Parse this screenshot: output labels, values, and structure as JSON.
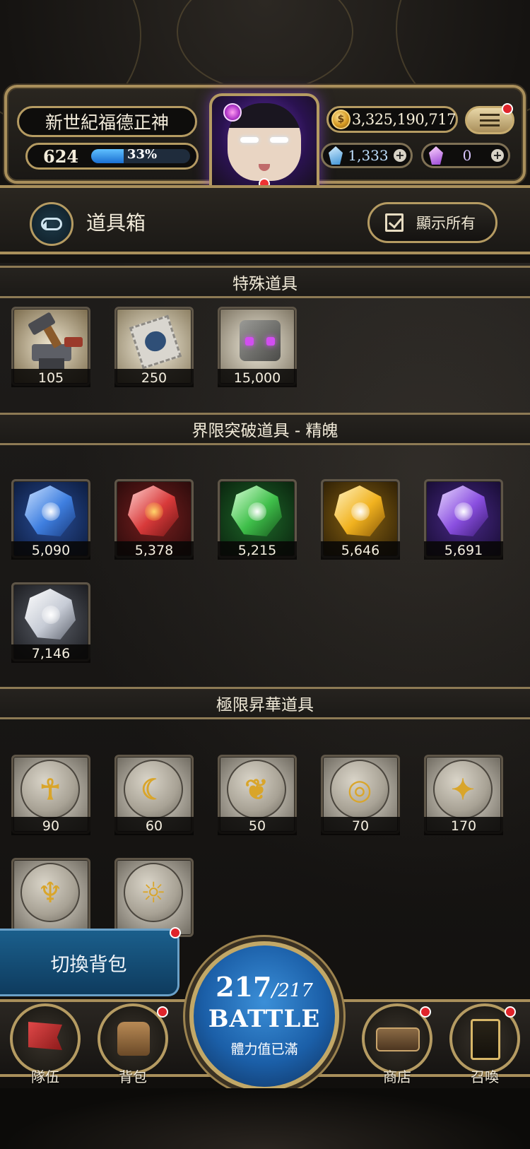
{
  "player": {
    "name": "新世紀福德正神",
    "level": "624",
    "exp_percent_text": "33%",
    "exp_fraction": 0.33
  },
  "currency": {
    "gold": "3,325,190,717",
    "blue_gems": "1,333",
    "purple_gems": "0"
  },
  "page": {
    "title": "道具箱",
    "show_all_label": "顯示所有"
  },
  "sections": [
    {
      "title": "特殊道具",
      "items": [
        {
          "icon": "hammer-anvil-icon",
          "count": "105"
        },
        {
          "icon": "ticket-icon",
          "count": "250"
        },
        {
          "icon": "cube-icon",
          "count": "15,000"
        }
      ]
    },
    {
      "title": "界限突破道具 - 精魄",
      "items": [
        {
          "icon": "blue-crystal-icon",
          "count": "5,090",
          "color": "#3f7fe0"
        },
        {
          "icon": "red-crystal-icon",
          "count": "5,378",
          "color": "#d83a3a"
        },
        {
          "icon": "green-crystal-icon",
          "count": "5,215",
          "color": "#3fbf4a"
        },
        {
          "icon": "yellow-crystal-icon",
          "count": "5,646",
          "color": "#f1b21f"
        },
        {
          "icon": "purple-crystal-icon",
          "count": "5,691",
          "color": "#8a4fe0"
        },
        {
          "icon": "white-crystal-icon",
          "count": "7,146",
          "color": "#c7ccd6"
        }
      ]
    },
    {
      "title": "極限昇華道具",
      "items": [
        {
          "icon": "ankh-rune-icon",
          "count": "90",
          "glyph": "☥"
        },
        {
          "icon": "crescent-rune-icon",
          "count": "60",
          "glyph": "☾"
        },
        {
          "icon": "leaf-rune-icon",
          "count": "50",
          "glyph": "❦"
        },
        {
          "icon": "circle-rune-icon",
          "count": "70",
          "glyph": "◎"
        },
        {
          "icon": "star-rune-icon",
          "count": "170",
          "glyph": "✦"
        },
        {
          "icon": "wings-rune-icon",
          "count": "",
          "glyph": "♆"
        },
        {
          "icon": "gear-rune-icon",
          "count": "",
          "glyph": "☼"
        }
      ]
    }
  ],
  "switch_bag_label": "切換背包",
  "battle": {
    "stamina_current": "217",
    "stamina_max": "/217",
    "label": "BATTLE",
    "status": "體力值已滿"
  },
  "nav": {
    "team": "隊伍",
    "bag": "背包",
    "shop": "商店",
    "summon": "召喚"
  }
}
